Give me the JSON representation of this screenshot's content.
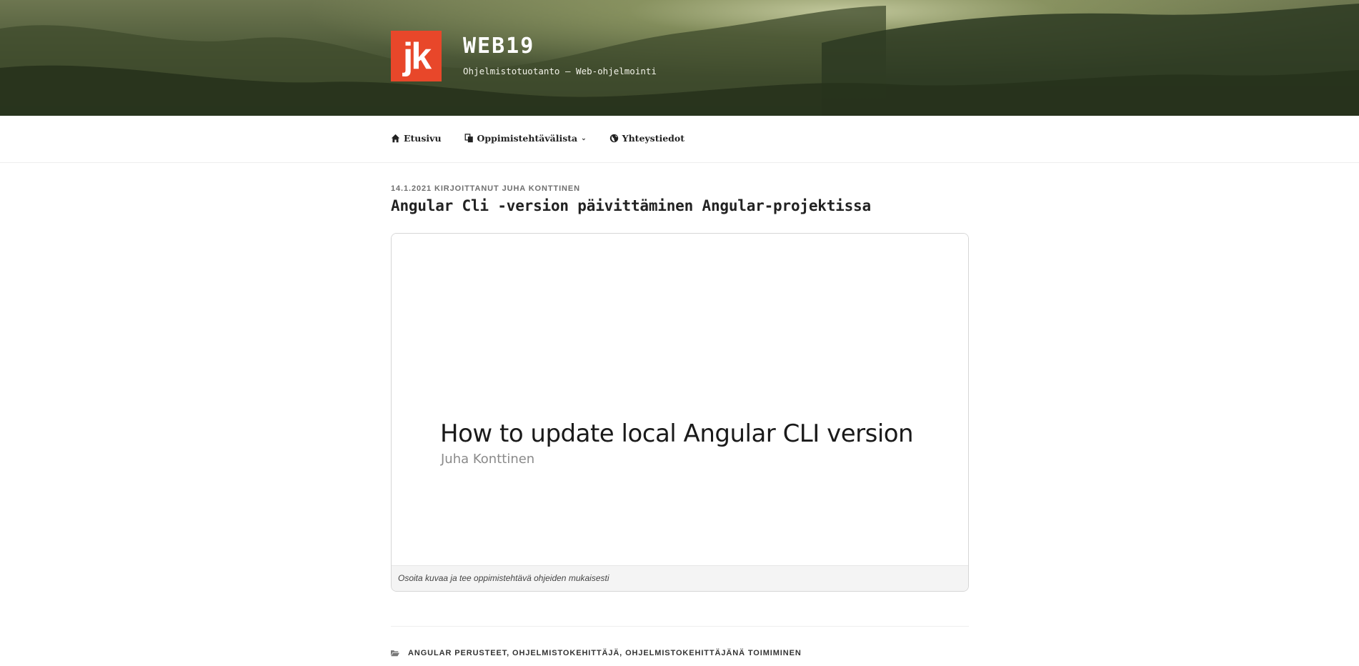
{
  "site": {
    "title": "WEB19",
    "description": "Ohjelmistotuotanto – Web-ohjelmointi",
    "logo_text": "jk",
    "logo_color": "#e8472a"
  },
  "nav": {
    "items": [
      {
        "label": "Etusivu",
        "icon": "home-icon"
      },
      {
        "label": "Oppimistehtävälista",
        "icon": "documents-icon",
        "has_submenu": true
      },
      {
        "label": "Yhteystiedot",
        "icon": "globe-icon"
      }
    ],
    "submenu_chevron": "⌄"
  },
  "post": {
    "meta": "14.1.2021 KIRJOITTANUT JUHA KONTTINEN",
    "title": "Angular Cli -version päivittäminen Angular-projektissa",
    "figure": {
      "slide_title": "How to update local Angular CLI version",
      "slide_author": "Juha Konttinen",
      "caption": "Osoita kuvaa ja tee oppimistehtävä ohjeiden mukaisesti"
    },
    "categories": {
      "icon": "folder-icon",
      "list": "ANGULAR PERUSTEET, OHJELMISTOKEHITTÄJÄ, OHJELMISTOKEHITTÄJÄNÄ TOIMIMINEN"
    }
  }
}
